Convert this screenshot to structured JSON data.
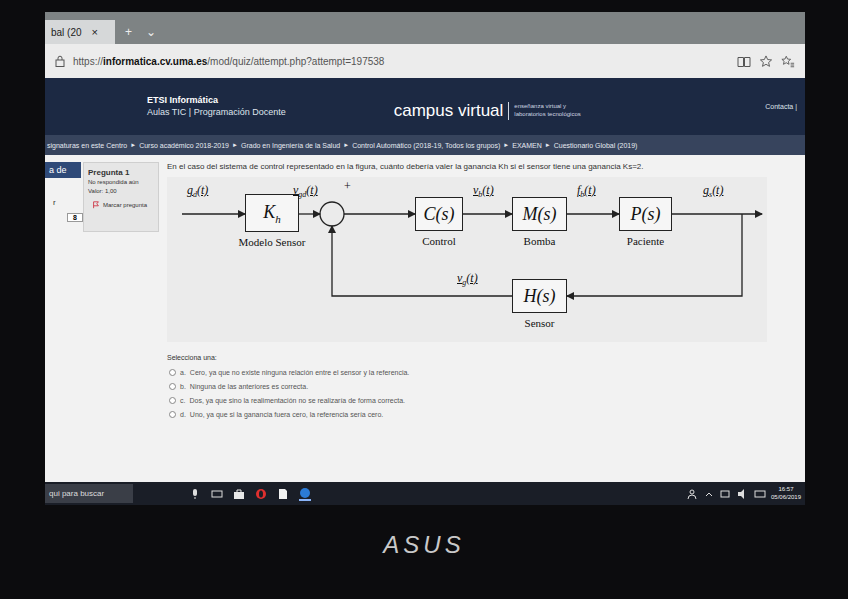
{
  "browser": {
    "tab": {
      "title": "bal (20",
      "close": "×",
      "new": "+",
      "menu": "⌄"
    },
    "address": {
      "scheme": "https://",
      "domain": "informatica.cv.uma.es",
      "path": "/mod/quiz/attempt.php?attempt=197538"
    }
  },
  "header": {
    "org": "ETSI Informática",
    "org_sub": "Aulas TIC | Programación Docente",
    "brand": "campus virtual",
    "brand_sub": [
      "enseñanza virtual y",
      "laboratorios tecnológicos"
    ],
    "contact": "Contacta |"
  },
  "breadcrumb": {
    "separator": "►",
    "items": [
      "signaturas en este Centro",
      "Curso académico 2018-2019",
      "Grado en Ingeniería de la Salud",
      "Control Automático (2018-19, Todos los grupos)",
      "EXAMEN",
      "Cuestionario Global (2019)"
    ]
  },
  "nav": {
    "heading": "a de",
    "label": "r",
    "button": "8"
  },
  "question_info": {
    "number": "Pregunta 1",
    "status": "No respondida aún",
    "value": "Valor: 1,00",
    "flag": "Marcar pregunta"
  },
  "question": {
    "text": "En el caso del sistema de control representado en la figura, cuánto debería valer la ganancia Kh si el sensor tiene una ganancia Ks=2.",
    "prompt": "Selecciona una:",
    "options": [
      {
        "letter": "a.",
        "text": "Cero, ya que no existe ninguna relación entre el sensor y la referencia.",
        "selected": false
      },
      {
        "letter": "b.",
        "text": "Ninguna de las anteriores es correcta.",
        "selected": false
      },
      {
        "letter": "c.",
        "text": "Dos, ya que sino la realimentación no se realizaría de forma correcta.",
        "selected": false
      },
      {
        "letter": "d.",
        "text": "Uno, ya que si la ganancia fuera cero, la referencia sería cero.",
        "selected": false
      }
    ]
  },
  "diagram": {
    "sum_sign": "+",
    "blocks": [
      {
        "main": "K",
        "sub": "h",
        "arg": "",
        "caption": "Modelo Sensor"
      },
      {
        "main": "C",
        "sub": "",
        "arg": "(s)",
        "caption": "Control"
      },
      {
        "main": "M",
        "sub": "",
        "arg": "(s)",
        "caption": "Bomba"
      },
      {
        "main": "P",
        "sub": "",
        "arg": "(s)",
        "caption": "Paciente"
      },
      {
        "main": "H",
        "sub": "",
        "arg": "(s)",
        "caption": "Sensor"
      }
    ],
    "signals": [
      {
        "sym": "g",
        "sub": "d",
        "arg": "(t)"
      },
      {
        "sym": "v",
        "sub": "gd",
        "arg": "(t)"
      },
      {
        "sym": "v",
        "sub": "b",
        "arg": "(t)"
      },
      {
        "sym": "f",
        "sub": "b",
        "arg": "(t)"
      },
      {
        "sym": "g",
        "sub": "s",
        "arg": "(t)"
      },
      {
        "sym": "v",
        "sub": "g",
        "arg": "(t)"
      }
    ]
  },
  "taskbar": {
    "search": "qui para buscar",
    "time": "16:57",
    "date": "05/06/2019"
  },
  "bezel": {
    "logo": "ASUS"
  }
}
